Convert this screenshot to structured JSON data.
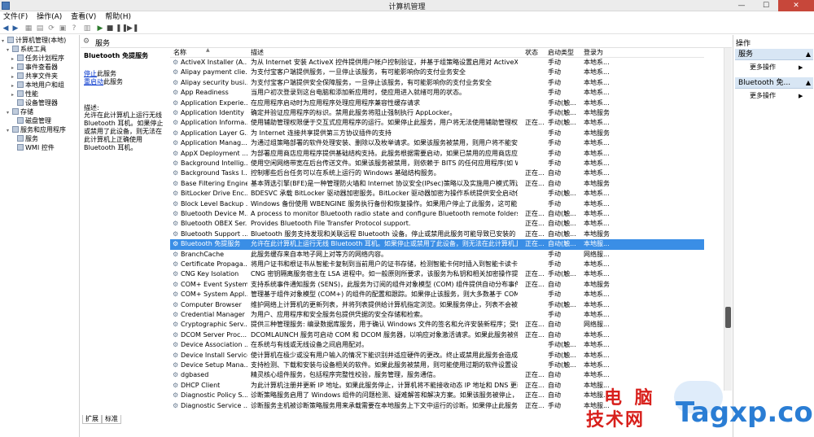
{
  "window": {
    "title": "计算机管理",
    "controls": [
      "—",
      "☐",
      "✕"
    ]
  },
  "menu": [
    "文件(F)",
    "操作(A)",
    "查看(V)",
    "帮助(H)"
  ],
  "tree": [
    {
      "label": "计算机管理(本地)",
      "depth": 0,
      "exp": "▾"
    },
    {
      "label": "系统工具",
      "depth": 1,
      "exp": "▾"
    },
    {
      "label": "任务计划程序",
      "depth": 2,
      "exp": "▸"
    },
    {
      "label": "事件查看器",
      "depth": 2,
      "exp": "▸"
    },
    {
      "label": "共享文件夹",
      "depth": 2,
      "exp": "▸"
    },
    {
      "label": "本地用户和组",
      "depth": 2,
      "exp": "▸"
    },
    {
      "label": "性能",
      "depth": 2,
      "exp": "▸"
    },
    {
      "label": "设备管理器",
      "depth": 2,
      "exp": ""
    },
    {
      "label": "存储",
      "depth": 1,
      "exp": "▾"
    },
    {
      "label": "磁盘管理",
      "depth": 2,
      "exp": ""
    },
    {
      "label": "服务和应用程序",
      "depth": 1,
      "exp": "▾"
    },
    {
      "label": "服务",
      "depth": 2,
      "exp": ""
    },
    {
      "label": "WMI 控件",
      "depth": 2,
      "exp": ""
    }
  ],
  "header": {
    "label": "服务"
  },
  "details": {
    "name": "Bluetooth 免提服务",
    "stop_link": "停止",
    "stop_suffix": "此服务",
    "restart_link": "重启动",
    "restart_suffix": "此服务",
    "desc_label": "描述:",
    "desc_text": "允许在此计算机上运行无线 Bluetooth 耳机。如果停止或禁用了此设备，则无法在此计算机上正确使用 Bluetooth 耳机。"
  },
  "columns": {
    "name": "名称",
    "desc": "描述",
    "state": "状态",
    "start": "启动类型",
    "logon": "登录为"
  },
  "rows": [
    {
      "name": "ActiveX Installer (A...",
      "desc": "为从 Internet 安装 ActiveX 控件提供用户帐户控制验证，并基于组策略设置启用对 ActiveX ...",
      "state": "",
      "start": "手动",
      "logon": "本地系..."
    },
    {
      "name": "Alipay payment clie...",
      "desc": "为支付宝客户端提供服务，一旦停止该服务，有可能影响你的支付业务安全",
      "state": "",
      "start": "手动",
      "logon": "本地系..."
    },
    {
      "name": "Alipay security busi...",
      "desc": "为支付宝客户端提供安全保障服务，一旦停止该服务，有可能影响你的支付业务安全",
      "state": "",
      "start": "手动",
      "logon": "本地系..."
    },
    {
      "name": "App Readiness",
      "desc": "当用户初次登录到这台电脑和添加新应用时，使应用进入就绪可用的状态。",
      "state": "",
      "start": "手动",
      "logon": "本地系..."
    },
    {
      "name": "Application Experie...",
      "desc": "在应用程序启动时为应用程序处理应用程序兼容性缓存请求",
      "state": "",
      "start": "手动(触...",
      "logon": "本地系..."
    },
    {
      "name": "Application Identity",
      "desc": "确定并验证应用程序的标识。禁用此服务将阻止强制执行 AppLocker。",
      "state": "",
      "start": "手动(触...",
      "logon": "本地服务"
    },
    {
      "name": "Application Informa...",
      "desc": "使用辅助管理权限便于交互式应用程序的运行。如果停止此服务，用户将无法使用辅助管理权...",
      "state": "正在...",
      "start": "手动(触...",
      "logon": "本地系..."
    },
    {
      "name": "Application Layer G...",
      "desc": "为 Internet 连接共享提供第三方协议插件的支持",
      "state": "",
      "start": "手动",
      "logon": "本地服务"
    },
    {
      "name": "Application Manag...",
      "desc": "为通过组策略部署的软件处理安装、删除以及枚举请求。如果该服务被禁用，则用户将不能安...",
      "state": "",
      "start": "手动",
      "logon": "本地系..."
    },
    {
      "name": "AppX Deployment ...",
      "desc": "为部署应用商店应用程序提供基础结构支持。此服务根据需要启动，如果已禁用的应用商店应...",
      "state": "",
      "start": "手动",
      "logon": "本地系..."
    },
    {
      "name": "Background Intellig...",
      "desc": "使用空闲网络带宽在后台传送文件。如果该服务被禁用，则依赖于 BITS 的任何应用程序(如 Wi...",
      "state": "",
      "start": "手动",
      "logon": "本地系..."
    },
    {
      "name": "Background Tasks I...",
      "desc": "控制哪些后台任务可以在系统上运行的 Windows 基础结构服务。",
      "state": "正在...",
      "start": "自动",
      "logon": "本地系..."
    },
    {
      "name": "Base Filtering Engine",
      "desc": "基本筛选引擎(BFE)是一种管理防火墙和 Internet 协议安全(IPsec)策略以及实施用户模式筛选...",
      "state": "正在...",
      "start": "自动",
      "logon": "本地服务"
    },
    {
      "name": "BitLocker Drive Enc...",
      "desc": "BDESVC 承载 BitLocker 驱动器加密服务。BitLocker 驱动器加密为操作系统提供安全启动保...",
      "state": "",
      "start": "手动(触...",
      "logon": "本地系..."
    },
    {
      "name": "Block Level Backup ...",
      "desc": "Windows 备份使用 WBENGINE 服务执行备份和恢复操作。如果用户停止了此服务，这可能会...",
      "state": "",
      "start": "手动",
      "logon": "本地系..."
    },
    {
      "name": "Bluetooth Device M...",
      "desc": "A process to monitor Bluetooth radio state and configure Bluetooth remote folders.",
      "state": "正在...",
      "start": "自动(触...",
      "logon": "本地系..."
    },
    {
      "name": "Bluetooth OBEX Ser...",
      "desc": "Provides Bluetooth File Transfer Protocol support.",
      "state": "正在...",
      "start": "自动(触...",
      "logon": "本地系..."
    },
    {
      "name": "Bluetooth Support ...",
      "desc": "Bluetooth 服务支持发现和关联远程 Bluetooth 设备。停止或禁用此服务可能导致已安装的 Bl...",
      "state": "正在...",
      "start": "自动(触...",
      "logon": "本地服务"
    },
    {
      "name": "Bluetooth 免提服务",
      "desc": "允许在此计算机上运行无线 Bluetooth 耳机。如果停止或禁用了此设备，则无法在此计算机上...",
      "state": "正在...",
      "start": "自动(触...",
      "logon": "本地服...",
      "selected": true
    },
    {
      "name": "BranchCache",
      "desc": "此服务缓存来自本地子网上对等方的网络内容。",
      "state": "",
      "start": "手动",
      "logon": "网络服..."
    },
    {
      "name": "Certificate Propaga...",
      "desc": "将用户证书和根证书从智能卡复制到当前用户的证书存储，检测智能卡何时插入到智能卡读卡...",
      "state": "",
      "start": "手动",
      "logon": "本地系..."
    },
    {
      "name": "CNG Key Isolation",
      "desc": "CNG 密钥隔离服务宿主在 LSA 进程中。如一般原则所要求，该服务为私钥和相关加密操作提...",
      "state": "正在...",
      "start": "手动(触...",
      "logon": "本地系..."
    },
    {
      "name": "COM+ Event System",
      "desc": "支持系统事件通知服务 (SENS)，此服务为订阅的组件对象模型 (COM) 组件提供自动分布事件...",
      "state": "正在...",
      "start": "自动",
      "logon": "本地服务"
    },
    {
      "name": "COM+ System Appl...",
      "desc": "管理基于组件对象模型 (COM+) 的组件的配置和跟踪。如果停止该服务，则大多数基于 COM...",
      "state": "",
      "start": "手动",
      "logon": "本地系..."
    },
    {
      "name": "Computer Browser",
      "desc": "维护网络上计算机的更新列表，并将列表提供给计算机指定浏览。如果服务停止，列表不会被...",
      "state": "",
      "start": "手动(触...",
      "logon": "本地系..."
    },
    {
      "name": "Credential Manager",
      "desc": "为用户、应用程序和安全服务包提供凭据的安全存储和检索。",
      "state": "",
      "start": "手动",
      "logon": "本地系..."
    },
    {
      "name": "Cryptographic Serv...",
      "desc": "提供三种管理服务: 编录数据库服务，用于确认 Windows 文件的签名和允许安装新程序；受保...",
      "state": "正在...",
      "start": "自动",
      "logon": "网络服..."
    },
    {
      "name": "DCOM Server Proc...",
      "desc": "DCOMLAUNCH 服务可启动 COM 和 DCOM 服务器，以响应对象激活请求。如果此服务被停...",
      "state": "正在...",
      "start": "自动",
      "logon": "本地系..."
    },
    {
      "name": "Device Association ...",
      "desc": "在系统与有线或无线设备之间启用配对。",
      "state": "",
      "start": "手动(触...",
      "logon": "本地系..."
    },
    {
      "name": "Device Install Service",
      "desc": "使计算机在极少或没有用户输入的情况下能识别并适应硬件的更改。终止或禁用此服务会造成...",
      "state": "",
      "start": "手动(触...",
      "logon": "本地系..."
    },
    {
      "name": "Device Setup Mana...",
      "desc": "支持检测、下载和安装与设备相关的软件。如果此服务被禁用，则可能使用过期的软件设置设...",
      "state": "",
      "start": "手动(触...",
      "logon": "本地系..."
    },
    {
      "name": "dgbased",
      "desc": "精灵核心组件服务，包括程序完整性校验，服务管理，服务通信。",
      "state": "正在...",
      "start": "自动",
      "logon": "本地系..."
    },
    {
      "name": "DHCP Client",
      "desc": "为此计算机注册并更新 IP 地址。如果此服务停止，计算机将不能接收动态 IP 地址和 DNS 更新...",
      "state": "正在...",
      "start": "自动",
      "logon": "本地服..."
    },
    {
      "name": "Diagnostic Policy S...",
      "desc": "诊断策略服务启用了 Windows 组件的问题检测、疑难解答和解决方案。如果该服务被停止，诊...",
      "state": "正在...",
      "start": "自动",
      "logon": "本地服..."
    },
    {
      "name": "Diagnostic Service ...",
      "desc": "诊断服务主机被诊断策略服务用来承载需要在本地服务上下文中运行的诊断。如果停止此服务...",
      "state": "正在...",
      "start": "手动",
      "logon": "本地服..."
    }
  ],
  "tabs": [
    "扩展",
    "标准"
  ],
  "actions": {
    "header": "操作",
    "sections": [
      {
        "label": "服务",
        "more": "更多操作"
      },
      {
        "label": "Bluetooth 免...",
        "more": "更多操作"
      }
    ]
  },
  "watermark": {
    "line1": "电 脑",
    "line2": "技术网",
    "site": "Tagxp.com"
  }
}
